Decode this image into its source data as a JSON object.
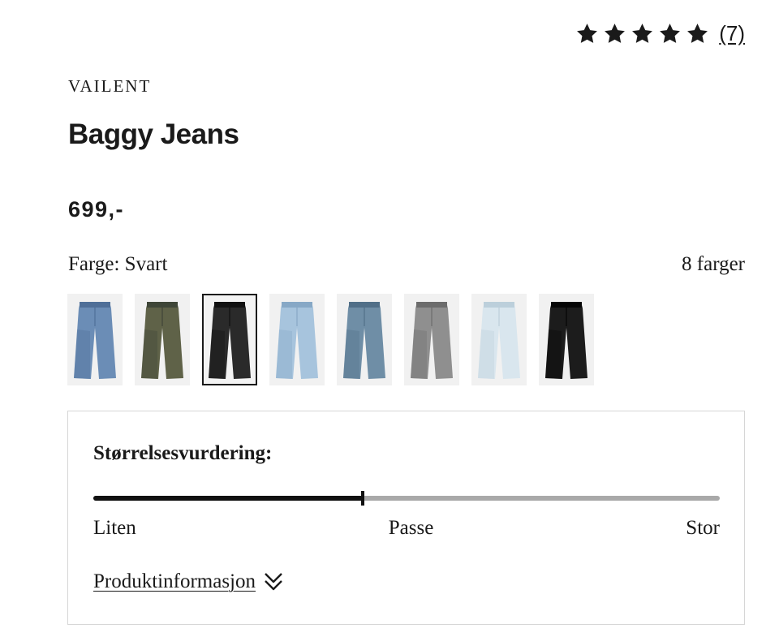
{
  "rating": {
    "stars": 5,
    "review_count": "(7)"
  },
  "product": {
    "brand": "VAILENT",
    "title": "Baggy Jeans",
    "price": "699,-"
  },
  "color": {
    "label": "Farge: Svart",
    "count_label": "8 farger",
    "selected_index": 2,
    "swatches": [
      {
        "name": "mid-blue-icon",
        "color": "#6b8db6",
        "shade": "#4f6f98"
      },
      {
        "name": "dirty-wash-icon",
        "color": "#5f6248",
        "shade": "#3f4638"
      },
      {
        "name": "washed-black-icon",
        "color": "#2a2a2a",
        "shade": "#111111"
      },
      {
        "name": "light-blue-icon",
        "color": "#a7c4dd",
        "shade": "#87a8c6"
      },
      {
        "name": "vintage-blue-icon",
        "color": "#6f8ea6",
        "shade": "#516f88"
      },
      {
        "name": "grey-icon",
        "color": "#8f8f8f",
        "shade": "#6c6c6c"
      },
      {
        "name": "ice-blue-icon",
        "color": "#d9e6ee",
        "shade": "#bccfdb"
      },
      {
        "name": "black-icon",
        "color": "#1c1c1c",
        "shade": "#050505"
      }
    ]
  },
  "size_rating": {
    "heading": "Størrelsesvurdering:",
    "value": 0.43,
    "labels": {
      "small": "Liten",
      "fit": "Passe",
      "large": "Stor"
    }
  },
  "product_info": {
    "label": "Produktinformasjon",
    "icon": "double-chevron-down-icon"
  }
}
